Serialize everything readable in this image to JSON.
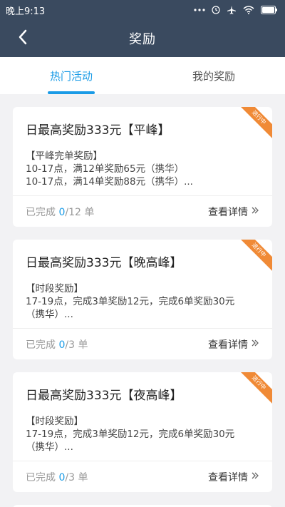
{
  "status_bar": {
    "time": "晚上9:13"
  },
  "nav": {
    "title": "奖励"
  },
  "tabs": [
    {
      "label": "热门活动",
      "active": true
    },
    {
      "label": "我的奖励",
      "active": false
    }
  ],
  "cards": [
    {
      "title": "日最高奖励333元【平峰】",
      "badge": "进行中",
      "desc_lines": [
        "【平峰完单奖励】",
        "10-17点，满12单奖励65元（携华）",
        "10-17点，满14单奖励88元（携华）..."
      ],
      "progress_prefix": "已完成",
      "progress_done": "0",
      "progress_suffix": "/12 单",
      "detail_label": "查看详情"
    },
    {
      "title": "日最高奖励333元【晚高峰】",
      "badge": "进行中",
      "desc_lines": [
        "【时段奖励】",
        "17-19点，完成3单奖励12元，完成6单奖励30元",
        "（携华）..."
      ],
      "progress_prefix": "已完成",
      "progress_done": "0",
      "progress_suffix": "/3 单",
      "detail_label": "查看详情"
    },
    {
      "title": "日最高奖励333元【夜高峰】",
      "badge": "进行中",
      "desc_lines": [
        "【时段奖励】",
        "17-19点，完成3单奖励12元，完成6单奖励30元",
        "（携华）..."
      ],
      "progress_prefix": "已完成",
      "progress_done": "0",
      "progress_suffix": "/3 单",
      "detail_label": "查看详情"
    }
  ],
  "colors": {
    "header_bg": "#3a4a5f",
    "accent": "#1a9be6",
    "badge": "#f08a36"
  },
  "icons": [
    "back-arrow-icon",
    "dots-icon",
    "wifi-icon",
    "airplane-icon",
    "battery-icon",
    "double-chevron-right-icon"
  ]
}
